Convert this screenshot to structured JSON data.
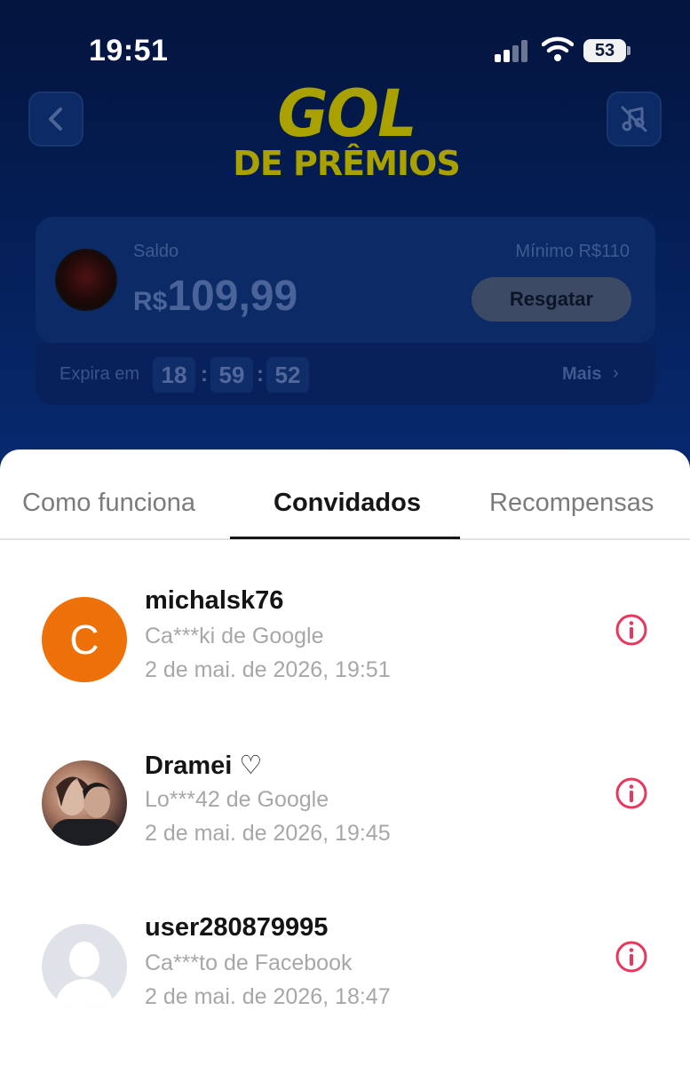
{
  "status_bar": {
    "time": "19:51",
    "battery": "53",
    "icons": [
      "cellular-signal-icon",
      "wifi-icon",
      "battery-icon"
    ]
  },
  "header": {
    "back_icon": "chevron-left-icon",
    "music_icon": "music-off-icon",
    "logo_line1": "GOL",
    "logo_line2": "DE PRÊMIOS"
  },
  "balance": {
    "label": "Saldo",
    "currency": "R$",
    "amount": "109,99",
    "minimum_label": "Mínimo  R$110",
    "redeem_button": "Resgatar",
    "expires_label": "Expira em",
    "timer_hours": "18",
    "timer_minutes": "59",
    "timer_seconds": "52",
    "timer_separator": ":",
    "more_label": "Mais",
    "more_chevron": "›"
  },
  "sheet": {
    "tabs": [
      {
        "label": "Como funciona",
        "active": false
      },
      {
        "label": "Convidados",
        "active": true
      },
      {
        "label": "Recompensas",
        "active": false
      }
    ],
    "invitees": [
      {
        "name": "michalsk76",
        "avatar_letter": "C",
        "source": "Ca***ki de Google",
        "date": "2 de mai. de 2026, 19:51"
      },
      {
        "name": "Dramei ♡",
        "source": "Lo***42 de Google",
        "date": "2 de mai. de 2026, 19:45"
      },
      {
        "name": "user280879995",
        "source": "Ca***to de Facebook",
        "date": "2 de mai. de 2026, 18:47"
      }
    ]
  },
  "colors": {
    "accent_info": "#e8365d",
    "letter_avatar": "#ee7008",
    "logo_yellow": "#a8a100",
    "background_navy": "#05205a"
  }
}
